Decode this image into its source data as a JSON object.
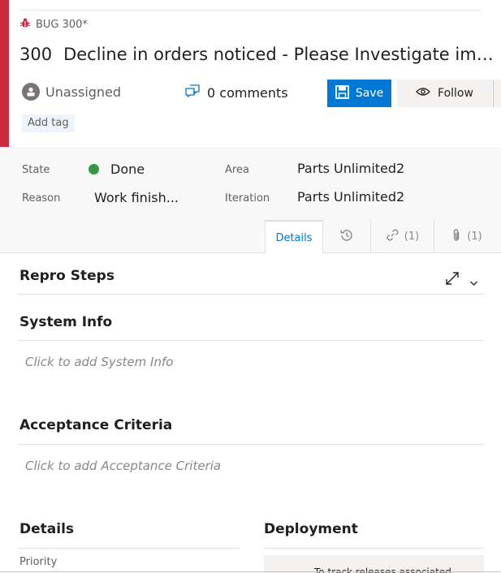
{
  "workitem": {
    "type_label": "BUG 300*",
    "id": "300",
    "title": "Decline in orders noticed - Please Investigate immed...",
    "assigned_to": "Unassigned",
    "comments_label": "0 comments",
    "save_label": "Save",
    "follow_label": "Follow",
    "add_tag_label": "Add tag",
    "accent_color": "#cc293d"
  },
  "fields": {
    "state_label": "State",
    "state_value": "Done",
    "state_color": "#339947",
    "reason_label": "Reason",
    "reason_value": "Work finish...",
    "area_label": "Area",
    "area_value": "Parts Unlimited2",
    "iteration_label": "Iteration",
    "iteration_value": "Parts Unlimited2"
  },
  "tabs": {
    "details": "Details",
    "history_icon": "history-icon",
    "links_count": "(1)",
    "attachments_count": "(1)"
  },
  "sections": {
    "repro_steps": "Repro Steps",
    "system_info": "System Info",
    "system_info_placeholder": "Click to add System Info",
    "acceptance_criteria": "Acceptance Criteria",
    "acceptance_placeholder": "Click to add Acceptance Criteria",
    "details": "Details",
    "priority_label": "Priority",
    "deployment": "Deployment",
    "deployment_text": "To track releases associated"
  }
}
